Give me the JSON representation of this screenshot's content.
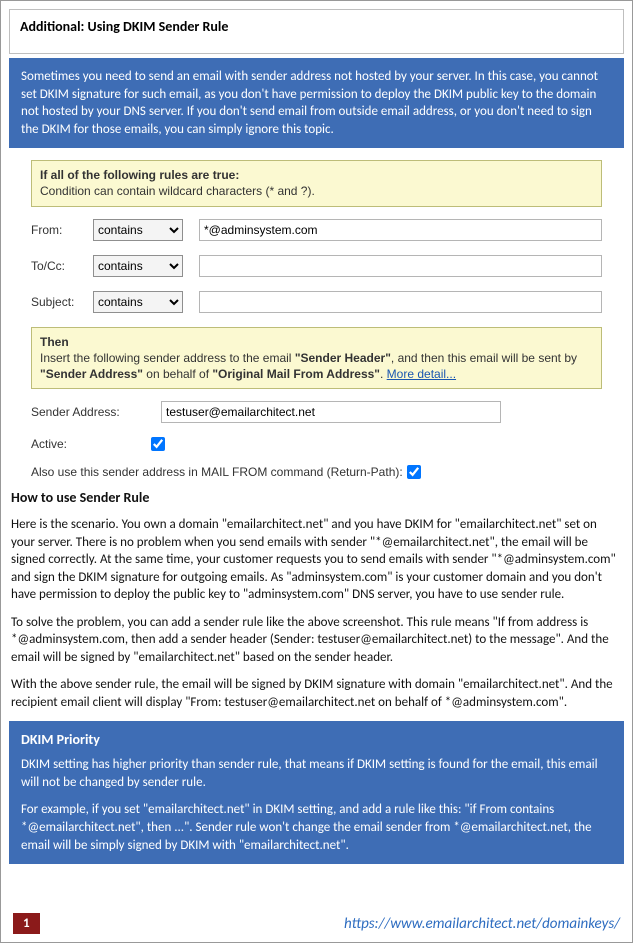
{
  "header": {
    "title": "Additional: Using DKIM Sender Rule"
  },
  "intro": "Sometimes you need to send an email with sender address not hosted by your server. In this case, you cannot set DKIM signature for such email, as you don't have permission to deploy the DKIM public key to the domain not hosted by your DNS server. If you don't send email from outside email address, or you don't need to sign the DKIM for those emails, you can simply ignore this topic.",
  "rules": {
    "if_title": "If all of the following rules are true:",
    "if_sub": "Condition can contain wildcard characters (* and ?).",
    "from_label": "From:",
    "from_op": "contains",
    "from_value": "*@adminsystem.com",
    "tocc_label": "To/Cc:",
    "tocc_op": "contains",
    "tocc_value": "",
    "subject_label": "Subject:",
    "subject_op": "contains",
    "subject_value": "",
    "then_label": "Then",
    "then_text1": "Insert the following sender address to the email ",
    "then_b1": "\"Sender Header\"",
    "then_text2": ", and then this email will be sent by ",
    "then_b2": "\"Sender Address\"",
    "then_text3": " on behalf of ",
    "then_b3": "\"Original Mail From Address\"",
    "then_text4": ". ",
    "more_detail": "More detail...",
    "sender_address_label": "Sender Address:",
    "sender_address_value": "testuser@emailarchitect.net",
    "active_label": "Active:",
    "active_checked": true,
    "return_path_label": "Also use this sender address in MAIL FROM command (Return-Path):",
    "return_path_checked": true
  },
  "howto": {
    "title": "How to use Sender Rule",
    "p1": "Here is the scenario. You own a domain \"emailarchitect.net\" and you have DKIM for \"emailarchitect.net\" set on your server. There is no problem when you send emails with sender \"*@emailarchitect.net\", the email will be signed correctly. At the same time, your customer requests you to send emails with sender \"*@adminsystem.com\" and sign the DKIM signature for outgoing emails. As \"adminsystem.com\" is your customer domain and you don't have permission to deploy the public key to \"adminsystem.com\" DNS server, you have to use sender rule.",
    "p2": "To solve the problem, you can add a sender rule like the above screenshot. This rule means \"If from address is *@adminsystem.com, then add a sender header (Sender: testuser@emailarchitect.net) to the message\". And the email will be signed by \"emailarchitect.net\" based on the sender header.",
    "p3": "With the above sender rule, the email will be signed by DKIM signature with domain \"emailarchitect.net\". And the recipient email client will display \"From: testuser@emailarchitect.net on behalf of *@adminsystem.com\"."
  },
  "priority": {
    "title": "DKIM Priority",
    "p1": "DKIM setting has higher priority than sender rule, that means if DKIM setting is found for the email, this email will not be changed by sender rule.",
    "p2": "For example, if you set \"emailarchitect.net\" in DKIM setting, and add a rule like this: \"if From contains *@emailarchitect.net\", then ...\". Sender rule won't change the email sender from *@emailarchitect.net, the email will be simply signed by DKIM with \"emailarchitect.net\"."
  },
  "footer": {
    "page": "1",
    "url": "https://www.emailarchitect.net/domainkeys/"
  }
}
